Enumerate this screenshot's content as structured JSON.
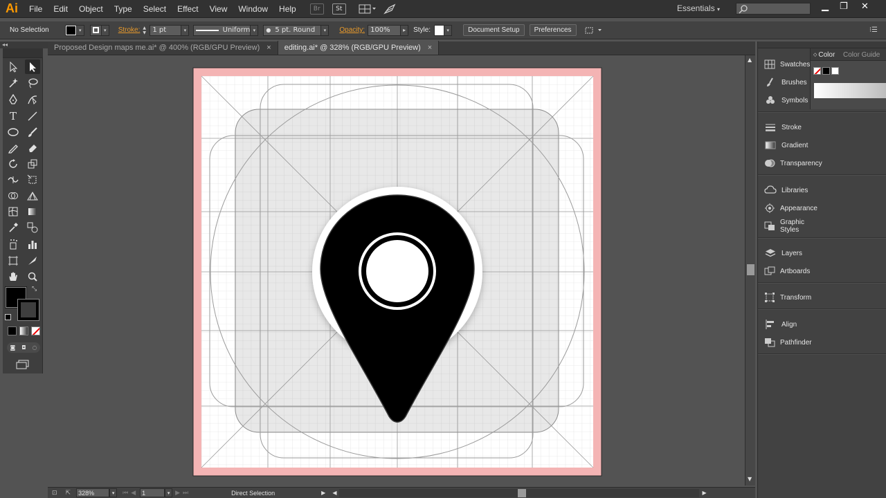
{
  "app": {
    "logo": "Ai"
  },
  "menu": [
    "File",
    "Edit",
    "Object",
    "Type",
    "Select",
    "Effect",
    "View",
    "Window",
    "Help"
  ],
  "menubar_icons": {
    "bridge": "Br",
    "stock": "St"
  },
  "workspace": {
    "label": "Essentials"
  },
  "control": {
    "selection_label": "No Selection",
    "stroke_label": "Stroke:",
    "stroke_weight": "1 pt",
    "variable_width": "Uniform",
    "brush": "5 pt. Round",
    "opacity_label": "Opacity:",
    "opacity_value": "100%",
    "style_label": "Style:",
    "document_setup": "Document Setup",
    "preferences": "Preferences"
  },
  "tabs": [
    {
      "label": "Proposed Design maps me.ai* @ 400% (RGB/GPU Preview)",
      "close": "×",
      "active": false
    },
    {
      "label": "editing.ai* @ 328% (RGB/GPU Preview)",
      "close": "×",
      "active": true
    }
  ],
  "status": {
    "zoom": "328%",
    "artboard": "1",
    "tool": "Direct Selection"
  },
  "panels": {
    "color_tabs": [
      "Color",
      "Color Guide"
    ],
    "group1": [
      "Swatches",
      "Brushes",
      "Symbols"
    ],
    "group2": [
      "Stroke",
      "Gradient",
      "Transparency"
    ],
    "group3": [
      "Libraries",
      "Appearance",
      "Graphic Styles"
    ],
    "group4": [
      "Layers",
      "Artboards"
    ],
    "group5": [
      "Transform"
    ],
    "group6": [
      "Align",
      "Pathfinder"
    ]
  },
  "colors": {
    "accent_orange": "#ff9a00",
    "bleed_pink": "#f4b4b4",
    "pin_fill": "#000000"
  }
}
